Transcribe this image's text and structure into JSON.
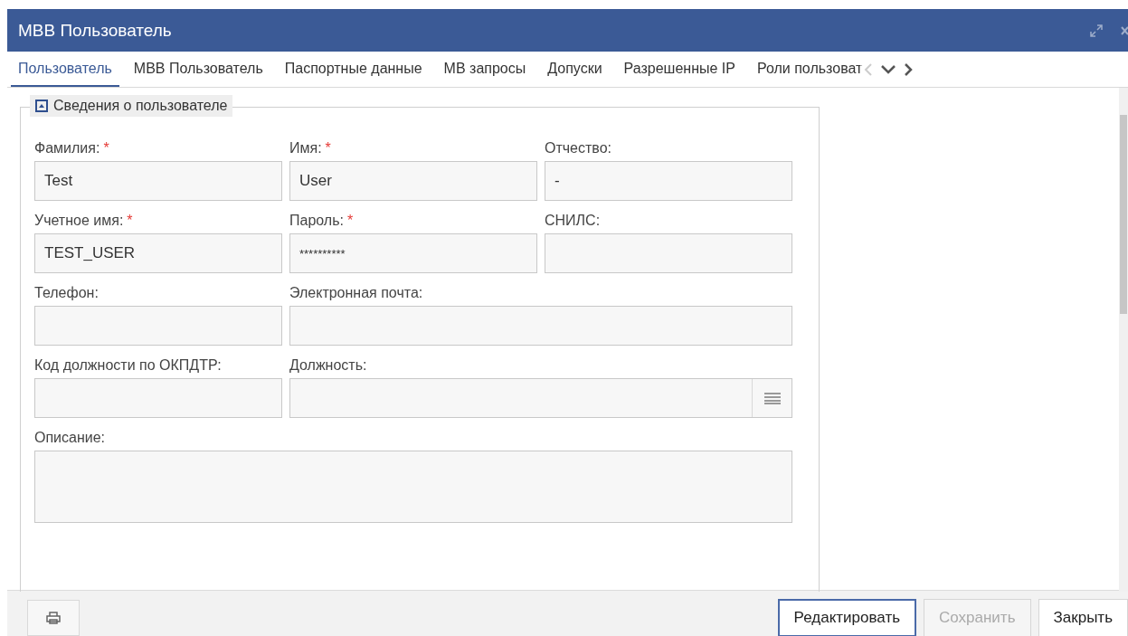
{
  "window": {
    "title": "МВВ Пользователь"
  },
  "tabs": [
    {
      "label": "Пользователь",
      "selected": true
    },
    {
      "label": "МВВ Пользователь",
      "selected": false
    },
    {
      "label": "Паспортные данные",
      "selected": false
    },
    {
      "label": "МВ запросы",
      "selected": false
    },
    {
      "label": "Допуски",
      "selected": false
    },
    {
      "label": "Разрешенные IP",
      "selected": false
    },
    {
      "label": "Роли пользоват",
      "selected": false
    }
  ],
  "section": {
    "title": "Сведения о пользователе",
    "expanded": true
  },
  "rows": [
    [
      {
        "label": "Фамилия:",
        "required_mark": "*",
        "kind": "text",
        "value": "Test"
      },
      {
        "label": "Имя:",
        "required_mark": "*",
        "kind": "text",
        "value": "User"
      },
      {
        "label": "Отчество:",
        "kind": "text",
        "value": "-"
      }
    ],
    [
      {
        "label": "Учетное имя:",
        "required_mark": "*",
        "kind": "text",
        "value": "TEST_USER"
      },
      {
        "label": "Пароль:",
        "required_mark": "*",
        "kind": "password",
        "value": "**********"
      },
      {
        "label": "СНИЛС:",
        "kind": "text"
      }
    ],
    [
      {
        "label": "Телефон:",
        "kind": "text"
      },
      {
        "label": "Электронная почта:",
        "kind": "text"
      }
    ],
    [
      {
        "label": "Код должности по ОКПДТР:",
        "kind": "text"
      },
      {
        "label": "Должность:",
        "kind": "lookup"
      }
    ],
    [
      {
        "label": "Описание:",
        "kind": "textarea"
      }
    ]
  ],
  "buttons": [
    {
      "label": "Редактировать",
      "disabled": false,
      "focused": true
    },
    {
      "label": "Сохранить",
      "disabled": true,
      "focused": false
    },
    {
      "label": "Закрыть",
      "disabled": false,
      "focused": false
    }
  ]
}
